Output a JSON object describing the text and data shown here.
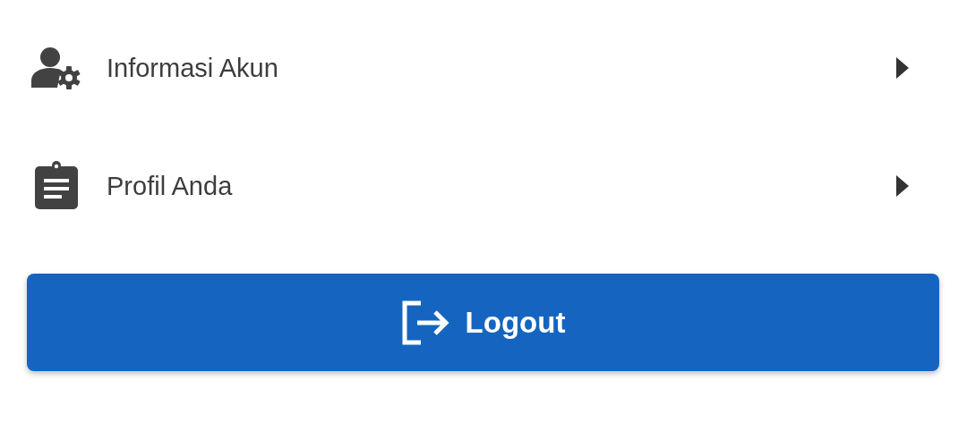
{
  "menu": [
    {
      "kind": "account",
      "label": "Informasi Akun"
    },
    {
      "kind": "profile",
      "label": "Profil Anda"
    }
  ],
  "logout_button": {
    "label": "Logout"
  }
}
